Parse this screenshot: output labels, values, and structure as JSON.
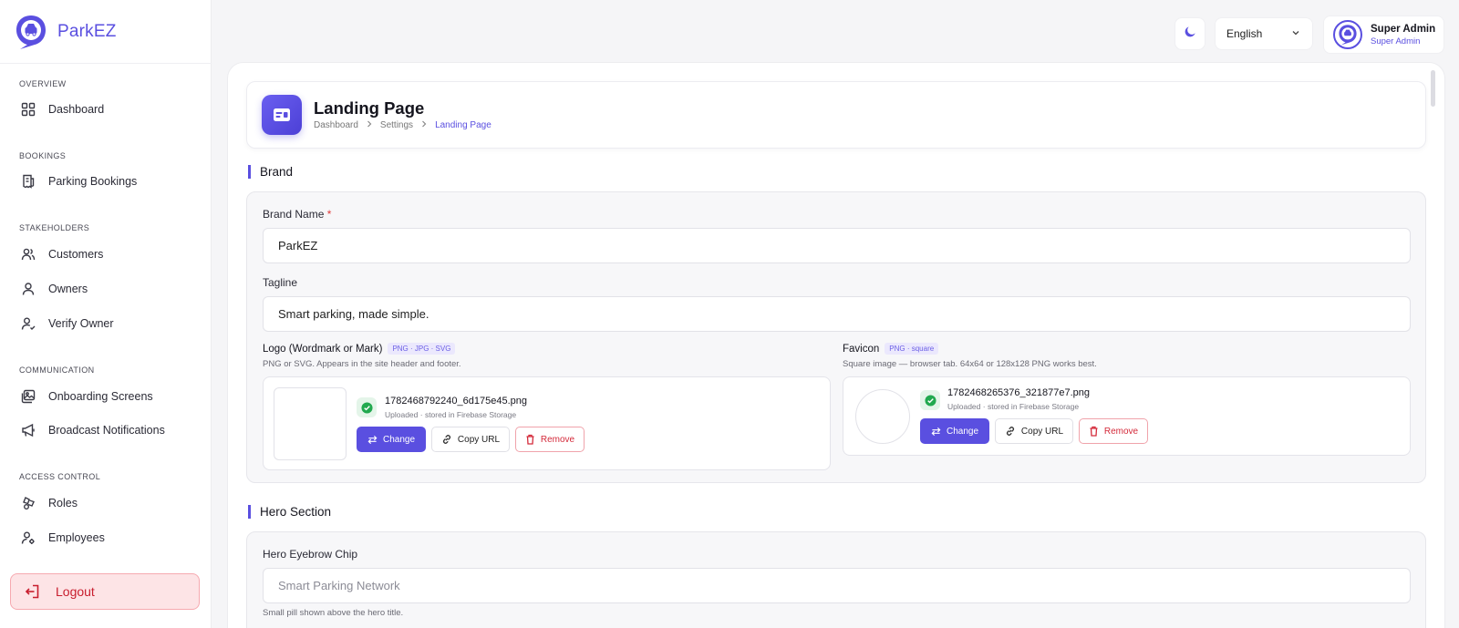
{
  "app": {
    "name": "ParkEZ",
    "accent": "#5a4fe0"
  },
  "sidebar": {
    "sections": [
      {
        "label": "OVERVIEW"
      },
      {
        "label": "BOOKINGS"
      },
      {
        "label": "STAKEHOLDERS"
      },
      {
        "label": "COMMUNICATION"
      },
      {
        "label": "ACCESS CONTROL"
      }
    ],
    "items": [
      {
        "label": "Dashboard",
        "icon": "grid-icon"
      },
      {
        "label": "Parking Bookings",
        "icon": "receipt-icon"
      },
      {
        "label": "Customers",
        "icon": "users-icon"
      },
      {
        "label": "Owners",
        "icon": "user-icon"
      },
      {
        "label": "Verify Owner",
        "icon": "user-check-icon"
      },
      {
        "label": "Onboarding Screens",
        "icon": "images-icon"
      },
      {
        "label": "Broadcast Notifications",
        "icon": "megaphone-icon"
      },
      {
        "label": "Roles",
        "icon": "roles-icon"
      },
      {
        "label": "Employees",
        "icon": "user-cog-icon"
      }
    ],
    "logout_label": "Logout"
  },
  "topbar": {
    "language": "English",
    "user_name": "Super Admin",
    "user_role": "Super Admin"
  },
  "page": {
    "title": "Landing Page",
    "breadcrumb": [
      "Dashboard",
      "Settings",
      "Landing Page"
    ]
  },
  "brand_section": {
    "title": "Brand",
    "brand_name_label": "Brand Name",
    "brand_name_required": "*",
    "brand_name_value": "ParkEZ",
    "tagline_label": "Tagline",
    "tagline_value": "Smart parking, made simple.",
    "logo": {
      "title": "Logo (Wordmark or Mark)",
      "chip": "PNG · JPG · SVG",
      "hint": "PNG or SVG. Appears in the site header and footer.",
      "file_name": "1782468792240_6d175e45.png",
      "file_sub": "Uploaded · stored in Firebase Storage",
      "change_label": "Change",
      "copy_label": "Copy URL",
      "remove_label": "Remove"
    },
    "favicon": {
      "title": "Favicon",
      "chip": "PNG · square",
      "hint": "Square image — browser tab. 64x64 or 128x128 PNG works best.",
      "file_name": "1782468265376_321877e7.png",
      "file_sub": "Uploaded · stored in Firebase Storage",
      "change_label": "Change",
      "copy_label": "Copy URL",
      "remove_label": "Remove"
    }
  },
  "hero_section": {
    "title": "Hero Section",
    "eyebrow_label": "Hero Eyebrow Chip",
    "eyebrow_placeholder": "Smart Parking Network",
    "eyebrow_hint": "Small pill shown above the hero title."
  }
}
